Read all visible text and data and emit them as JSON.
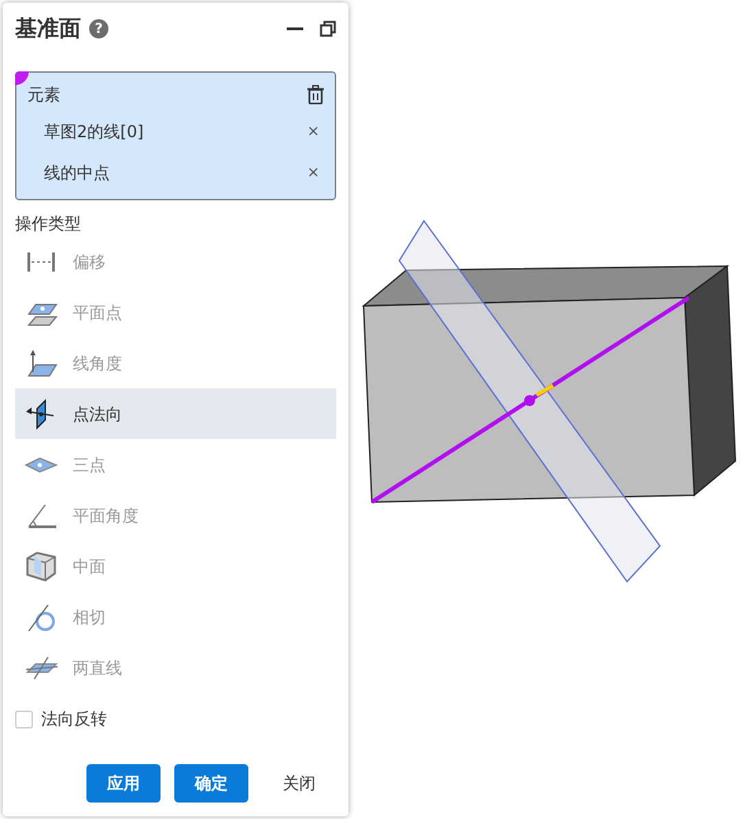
{
  "panel": {
    "title": "基准面",
    "help": "?"
  },
  "selection": {
    "title": "元素",
    "items": [
      {
        "label": "草图2的线[0]",
        "remove": "×"
      },
      {
        "label": "线的中点",
        "remove": "×"
      }
    ]
  },
  "operation_type": {
    "label": "操作类型",
    "items": [
      {
        "kind": "offset",
        "label": "偏移",
        "selected": false
      },
      {
        "kind": "plane-point",
        "label": "平面点",
        "selected": false
      },
      {
        "kind": "line-angle",
        "label": "线角度",
        "selected": false
      },
      {
        "kind": "point-normal",
        "label": "点法向",
        "selected": true
      },
      {
        "kind": "three-point",
        "label": "三点",
        "selected": false
      },
      {
        "kind": "plane-angle",
        "label": "平面角度",
        "selected": false
      },
      {
        "kind": "mid-plane",
        "label": "中面",
        "selected": false
      },
      {
        "kind": "tangent",
        "label": "相切",
        "selected": false
      },
      {
        "kind": "two-lines",
        "label": "两直线",
        "selected": false
      }
    ]
  },
  "reverse_normal": {
    "label": "法向反转",
    "checked": false
  },
  "buttons": [
    {
      "kind": "primary",
      "label": "应用"
    },
    {
      "kind": "primary",
      "label": "确定"
    },
    {
      "kind": "link",
      "label": "关闭"
    }
  ]
}
